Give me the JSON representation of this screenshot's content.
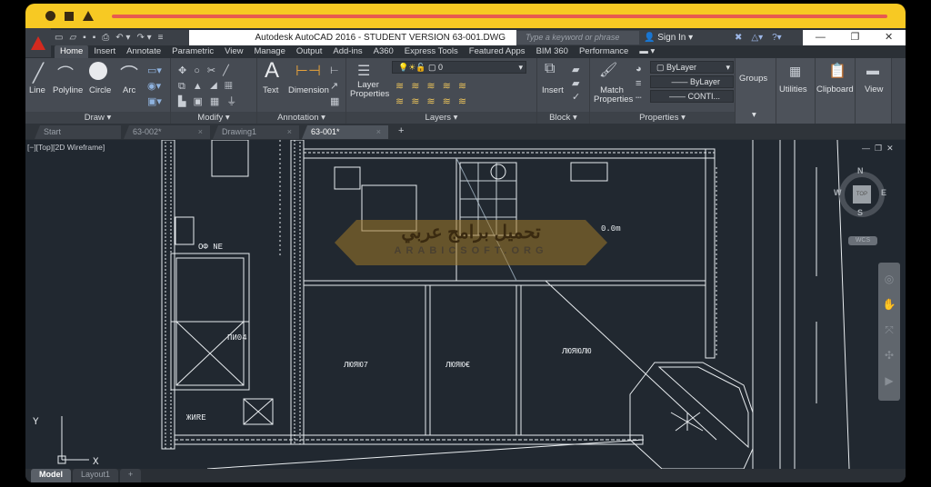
{
  "title": "Autodesk AutoCAD 2016 - STUDENT VERSION    63-001.DWG",
  "search_placeholder": "Type a keyword or phrase",
  "sign_in": "Sign In",
  "window_controls": [
    "—",
    "❐",
    "✕"
  ],
  "menu_tabs": [
    "Home",
    "Insert",
    "Annotate",
    "Parametric",
    "View",
    "Manage",
    "Output",
    "Add-ins",
    "A360",
    "Express Tools",
    "Featured Apps",
    "BIM 360",
    "Performance"
  ],
  "ribbon": {
    "draw": {
      "label": "Draw ▾",
      "tools": [
        "Line",
        "Polyline",
        "Circle",
        "Arc"
      ]
    },
    "modify": {
      "label": "Modify ▾"
    },
    "annotation": {
      "label": "Annotation ▾",
      "tools": [
        "Text",
        "Dimension"
      ]
    },
    "layers": {
      "label": "Layers ▾",
      "tool": "Layer Properties",
      "current_layer": "0"
    },
    "block": {
      "label": "Block ▾",
      "tool": "Insert"
    },
    "properties": {
      "label": "Properties ▾",
      "tool": "Match Properties",
      "color": "ByLayer",
      "linetype": "ByLayer",
      "lineweight": "CONTI..."
    },
    "groups": "Groups",
    "utilities": "Utilities",
    "clipboard": "Clipboard",
    "view": "View"
  },
  "file_tabs": [
    "Start",
    "63-002*",
    "Drawing1",
    "63-001*"
  ],
  "viewport_label": "[−][Top][2D Wireframe]",
  "viewcube": {
    "top": "TOP",
    "n": "N",
    "s": "S",
    "e": "E",
    "w": "W",
    "wcs": "WCS"
  },
  "ucs": {
    "x": "X",
    "y": "Y"
  },
  "layout_tabs": [
    "Model",
    "Layout1",
    "+"
  ],
  "watermark": {
    "arabic": "تحميل برامج عربي",
    "latin": "ARABICSOFT.ORG"
  },
  "drawing_labels": [
    "ОФ NE",
    "ПИ04",
    "ЖИRE",
    "ЛЮЯЮ7",
    "ЛЮЯЮ€",
    "ЛЮЯЮЛЮ",
    "0.0m"
  ]
}
